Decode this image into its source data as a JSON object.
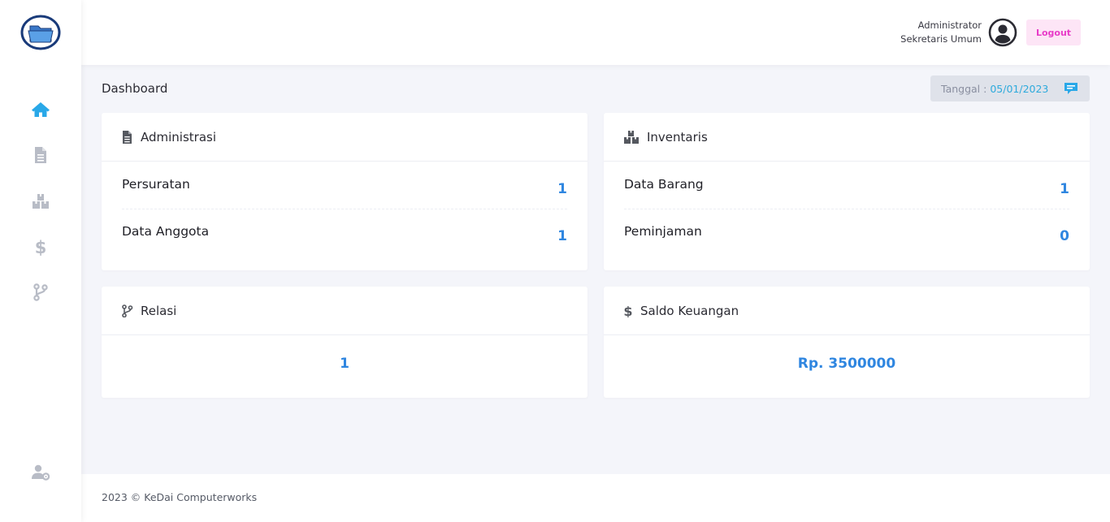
{
  "header": {
    "user_name": "Administrator",
    "user_role": "Sekretaris Umum",
    "logout_label": "Logout"
  },
  "page": {
    "title": "Dashboard",
    "date_label": "Tanggal :",
    "date_value": "05/01/2023"
  },
  "sidebar": {
    "items": [
      {
        "icon": "home-icon",
        "active": true
      },
      {
        "icon": "document-icon",
        "active": false
      },
      {
        "icon": "boxes-icon",
        "active": false
      },
      {
        "icon": "dollar-icon",
        "active": false
      },
      {
        "icon": "branch-icon",
        "active": false
      }
    ],
    "bottom_icon": "user-settings-icon"
  },
  "cards": {
    "administrasi": {
      "title": "Administrasi",
      "rows": [
        {
          "label": "Persuratan",
          "value": "1"
        },
        {
          "label": "Data Anggota",
          "value": "1"
        }
      ]
    },
    "inventaris": {
      "title": "Inventaris",
      "rows": [
        {
          "label": "Data Barang",
          "value": "1"
        },
        {
          "label": "Peminjaman",
          "value": "0"
        }
      ]
    },
    "relasi": {
      "title": "Relasi",
      "value": "1"
    },
    "saldo": {
      "title": "Saldo Keuangan",
      "value": "Rp. 3500000"
    }
  },
  "footer": {
    "text": "2023 © KeDai Computerworks"
  },
  "colors": {
    "accent": "#2f86e0",
    "active_icon": "#29a8e8",
    "inactive_icon": "#b8bcc6",
    "logout_bg": "#fde5f6",
    "logout_text": "#e83bc8"
  }
}
